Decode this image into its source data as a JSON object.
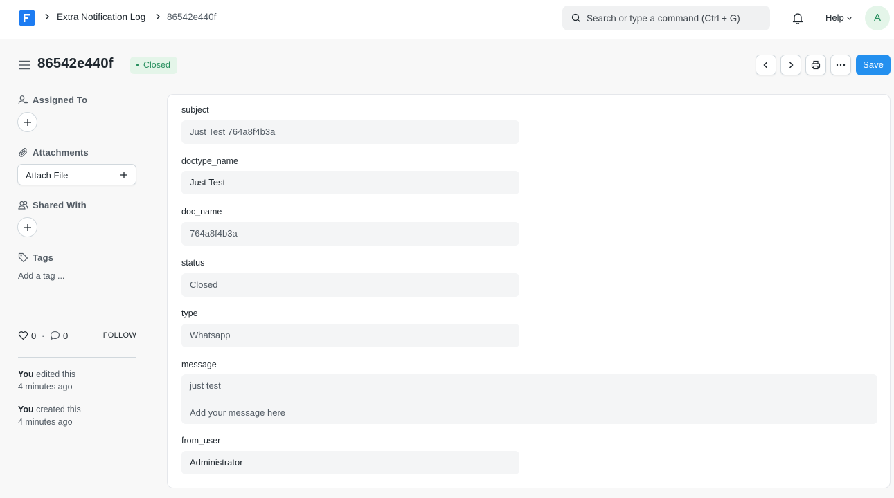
{
  "navbar": {
    "breadcrumbs": [
      "Extra Notification Log",
      "86542e440f"
    ],
    "search_placeholder": "Search or type a command (Ctrl + G)",
    "help_label": "Help",
    "avatar_initial": "A"
  },
  "header": {
    "title": "86542e440f",
    "status": "Closed",
    "save_label": "Save"
  },
  "sidebar": {
    "assigned_to_label": "Assigned To",
    "attachments_label": "Attachments",
    "attach_file_label": "Attach File",
    "shared_with_label": "Shared With",
    "tags_label": "Tags",
    "add_tag_label": "Add a tag ...",
    "likes": "0",
    "comments": "0",
    "follow_label": "FOLLOW",
    "activity": [
      {
        "actor": "You",
        "action": "edited this",
        "time": "4 minutes ago"
      },
      {
        "actor": "You",
        "action": "created this",
        "time": "4 minutes ago"
      }
    ]
  },
  "form": {
    "fields": [
      {
        "label": "subject",
        "value": "Just Test 764a8f4b3a"
      },
      {
        "label": "doctype_name",
        "value": "Just Test"
      },
      {
        "label": "doc_name",
        "value": "764a8f4b3a"
      },
      {
        "label": "status",
        "value": "Closed"
      },
      {
        "label": "type",
        "value": "Whatsapp"
      },
      {
        "label": "message",
        "value": "just test",
        "placeholder": "Add your message here"
      },
      {
        "label": "from_user",
        "value": "Administrator"
      }
    ]
  },
  "colors": {
    "primary": "#2490ef",
    "logo": "#1d7cf2",
    "success_bg": "#e4f5e9",
    "success_text": "#278f5e"
  }
}
